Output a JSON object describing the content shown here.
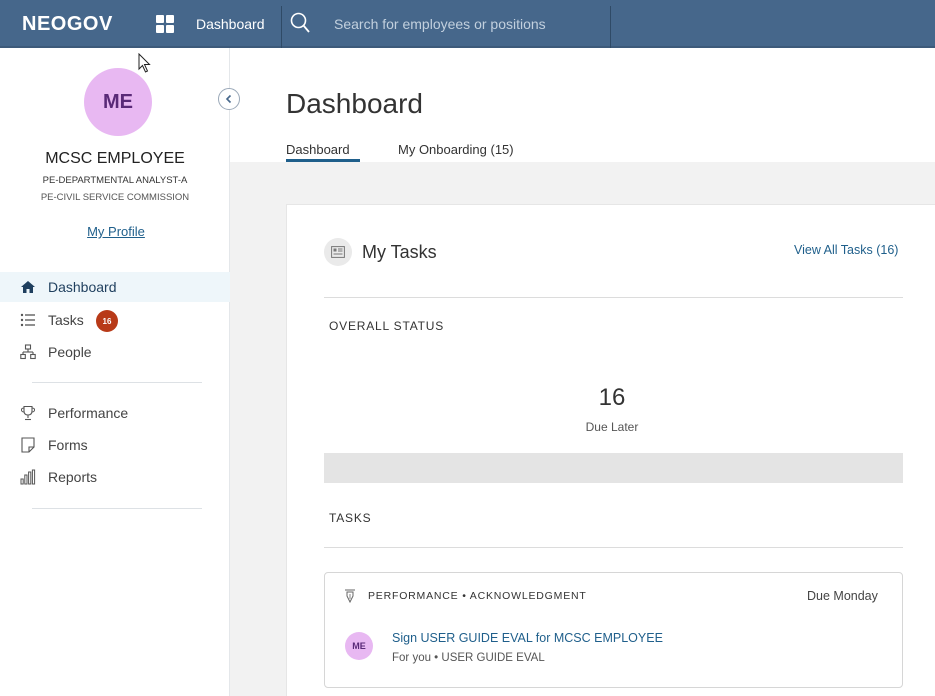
{
  "topbar": {
    "logo": "NEOGOV",
    "dashboard_link": "Dashboard",
    "search_placeholder": "Search for employees or positions",
    "bg_color": "#46678b"
  },
  "sidebar": {
    "avatar_initials": "ME",
    "employee_name": "MCSC EMPLOYEE",
    "employee_title": "PE-DEPARTMENTAL ANALYST-A",
    "employee_department": "PE-CIVIL SERVICE COMMISSION",
    "my_profile_link": "My Profile",
    "nav_items": [
      {
        "label": "Dashboard",
        "icon": "home-icon",
        "active": true
      },
      {
        "label": "Tasks",
        "icon": "list-icon",
        "badge": "16"
      },
      {
        "label": "People",
        "icon": "org-chart-icon"
      },
      {
        "label": "Performance",
        "icon": "trophy-icon"
      },
      {
        "label": "Forms",
        "icon": "form-icon"
      },
      {
        "label": "Reports",
        "icon": "bar-chart-icon"
      }
    ]
  },
  "main": {
    "page_title": "Dashboard",
    "tabs": [
      {
        "label": "Dashboard",
        "active": true
      },
      {
        "label": "My Onboarding (15)",
        "active": false
      }
    ],
    "card": {
      "title": "My Tasks",
      "view_all": "View All Tasks (16)",
      "overall_status_label": "OVERALL STATUS",
      "count": "16",
      "count_label": "Due Later",
      "tasks_label": "TASKS",
      "task": {
        "category": "PERFORMANCE • ACKNOWLEDGMENT",
        "due": "Due Monday",
        "avatar_initials": "ME",
        "title": "Sign USER GUIDE EVAL for MCSC EMPLOYEE",
        "subtitle": "For you • USER GUIDE EVAL"
      }
    }
  },
  "colors": {
    "accent": "#1f5f8b",
    "avatar": "#e8b8f2",
    "badge": "#b83a18"
  }
}
